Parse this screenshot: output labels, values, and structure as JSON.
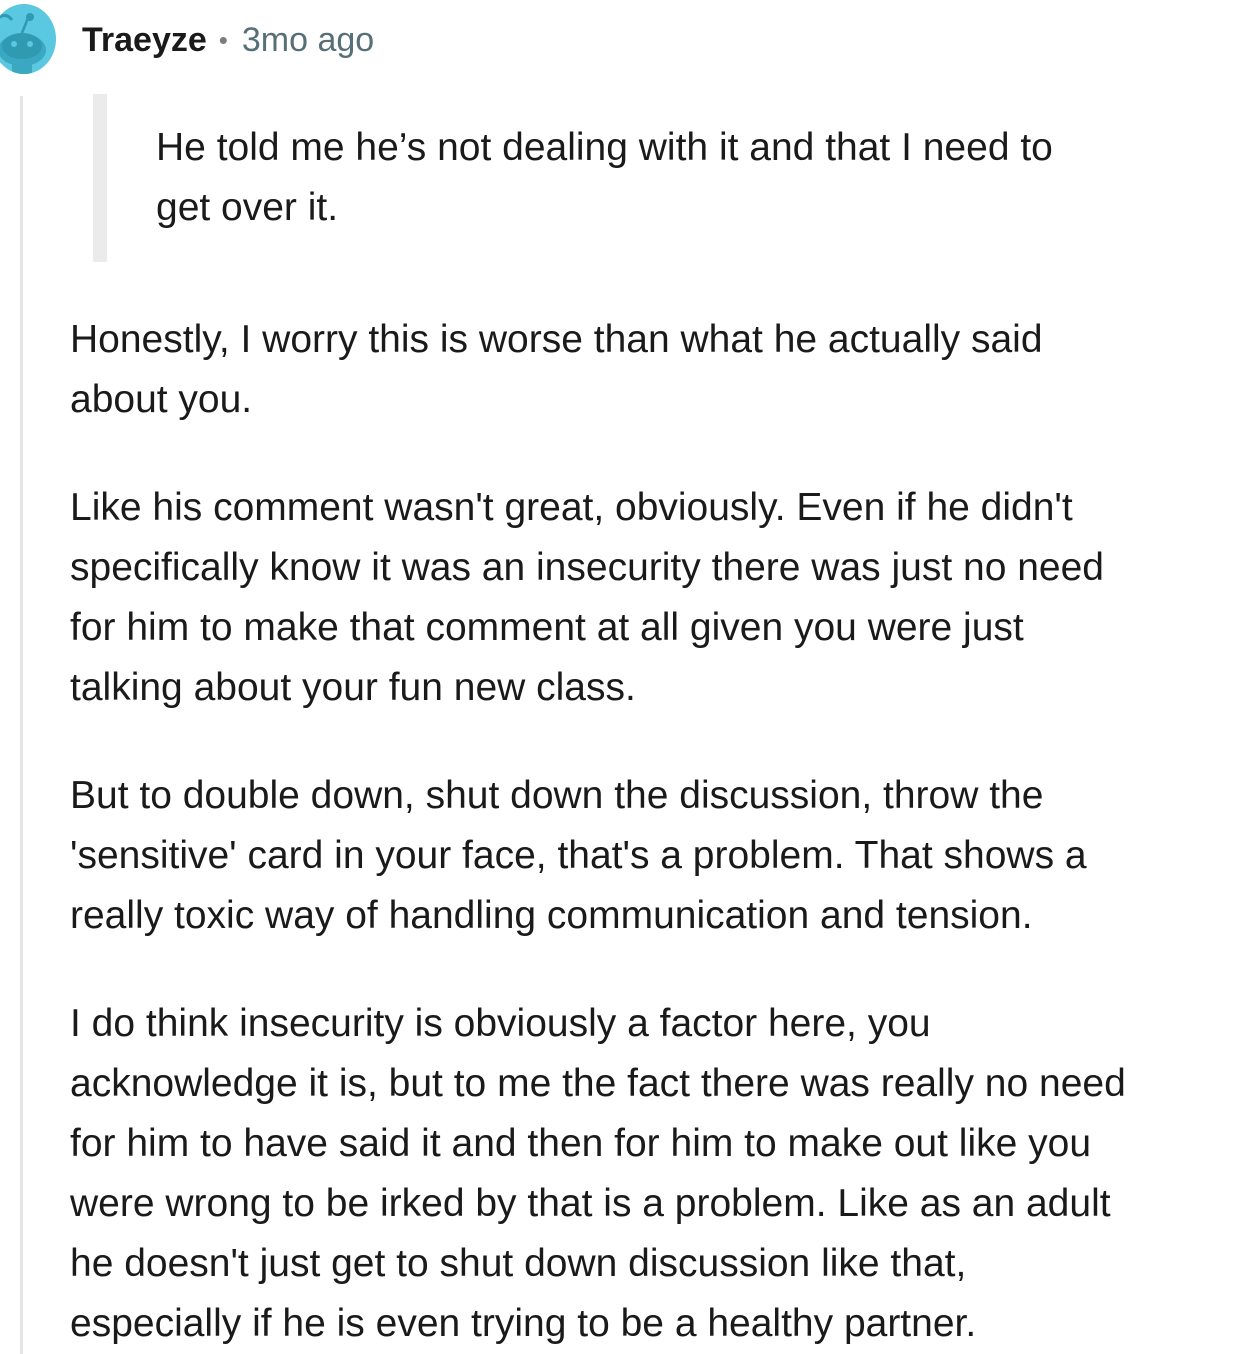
{
  "comment": {
    "author": "Traeyze",
    "separator": "•",
    "timestamp": "3mo ago",
    "avatar_icon": "reddit-snoo-avatar-icon",
    "colors": {
      "avatar_bg": "#5ac8e0",
      "avatar_fg": "#3aa8c0",
      "thread_line": "#e6e6e6",
      "quote_bar": "#ebebeb",
      "meta_text": "#576f76"
    },
    "quote": {
      "lines": [
        "He told me he’s not dealing with it and that I need to",
        "get over it."
      ]
    },
    "paragraphs": [
      {
        "lines": [
          "Honestly, I worry this is worse than what he actually said",
          "about you."
        ]
      },
      {
        "lines": [
          "Like his comment wasn't great, obviously. Even if he didn't",
          "specifically know it was an insecurity there was just no need",
          "for him to make that comment at all given you were just",
          "talking about your fun new class."
        ]
      },
      {
        "lines": [
          "But to double down, shut down the discussion, throw the",
          "'sensitive' card in your face, that's a problem. That shows a",
          "really toxic way of handling communication and tension."
        ]
      },
      {
        "lines": [
          "I do think insecurity is obviously a factor here, you",
          "acknowledge it is, but to me the fact there was really no need",
          "for him to have said it and then for him to make out like you",
          "were wrong to be irked by that is a problem. Like as an adult",
          "he doesn't just get to shut down discussion like that,",
          "especially if he is even trying to be a healthy partner."
        ]
      }
    ]
  }
}
